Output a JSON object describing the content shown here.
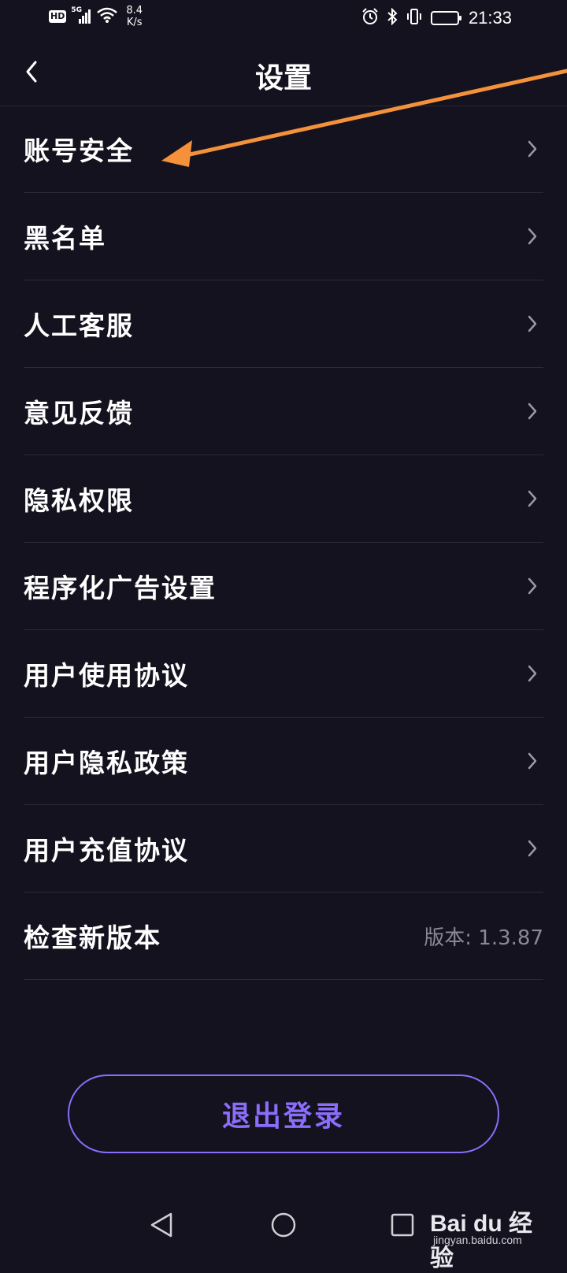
{
  "status_bar": {
    "hd": "HD",
    "network": "5G",
    "speed_value": "8.4",
    "speed_unit": "K/s",
    "battery": "94",
    "time": "21:33"
  },
  "header": {
    "title": "设置"
  },
  "menu": [
    {
      "label": "账号安全"
    },
    {
      "label": "黑名单"
    },
    {
      "label": "人工客服"
    },
    {
      "label": "意见反馈"
    },
    {
      "label": "隐私权限"
    },
    {
      "label": "程序化广告设置"
    },
    {
      "label": "用户使用协议"
    },
    {
      "label": "用户隐私政策"
    },
    {
      "label": "用户充值协议"
    },
    {
      "label": "检查新版本",
      "value": "版本: 1.3.87"
    }
  ],
  "logout_label": "退出登录",
  "watermark": {
    "brand": "Bai du 经验",
    "url": "jingyan.baidu.com"
  },
  "colors": {
    "background": "#14121e",
    "accent": "#8b6dfb",
    "annotation_arrow": "#f4913a"
  }
}
